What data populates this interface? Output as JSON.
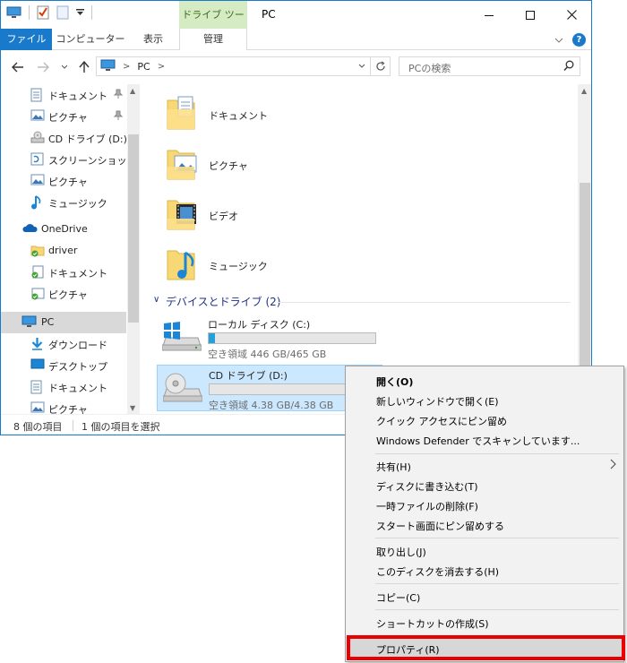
{
  "window": {
    "title": "PC",
    "context_tab_group": "ドライブ ツール"
  },
  "ribbon": {
    "tabs": [
      "ファイル",
      "コンピューター",
      "表示",
      "管理"
    ],
    "help": "?"
  },
  "address_bar": {
    "crumb": "PC",
    "search_placeholder": "PCの検索"
  },
  "nav_pane": {
    "items": [
      {
        "label": "ドキュメント",
        "pinned": true
      },
      {
        "label": "ピクチャ",
        "pinned": true
      },
      {
        "label": "CD ドライブ (D:)"
      },
      {
        "label": "スクリーンショット"
      },
      {
        "label": "ピクチャ"
      },
      {
        "label": "ミュージック"
      },
      {
        "label": "OneDrive"
      },
      {
        "label": "driver"
      },
      {
        "label": "ドキュメント"
      },
      {
        "label": "ピクチャ"
      },
      {
        "label": "PC"
      },
      {
        "label": "ダウンロード"
      },
      {
        "label": "デスクトップ"
      },
      {
        "label": "ドキュメント"
      },
      {
        "label": "ピクチャ"
      }
    ]
  },
  "content": {
    "folders": [
      "ドキュメント",
      "ピクチャ",
      "ビデオ",
      "ミュージック"
    ],
    "group_header": "デバイスとドライブ (2)",
    "drives": [
      {
        "name": "ローカル ディスク (C:)",
        "free_text": "空き領域 446 GB/465 GB",
        "used_fraction": 0.04
      },
      {
        "name": "CD ドライブ (D:)",
        "free_text": "空き領域 4.38 GB/4.38 GB",
        "used_fraction": 0.0
      }
    ]
  },
  "status_bar": {
    "item_count": "8 個の項目",
    "selected_count": "1 個の項目を選択"
  },
  "context_menu": {
    "items": [
      {
        "label": "開く(O)",
        "bold": true
      },
      {
        "label": "新しいウィンドウで開く(E)"
      },
      {
        "label": "クイック アクセスにピン留め"
      },
      {
        "label": "Windows Defender でスキャンしています..."
      },
      {
        "label": "共有(H)",
        "submenu": true
      },
      {
        "label": "ディスクに書き込む(T)"
      },
      {
        "label": "一時ファイルの削除(F)"
      },
      {
        "label": "スタート画面にピン留めする"
      },
      {
        "label": "取り出し(J)"
      },
      {
        "label": "このディスクを消去する(H)"
      },
      {
        "label": "コピー(C)"
      },
      {
        "label": "ショートカットの作成(S)"
      },
      {
        "label": "プロパティ(R)",
        "highlighted": true
      }
    ]
  },
  "colors": {
    "accent": "#1979ca",
    "selection": "#cce8ff",
    "highlight_box": "#ea0000",
    "drive_tools": "#d5ebc3",
    "folder": "#f8d775"
  }
}
